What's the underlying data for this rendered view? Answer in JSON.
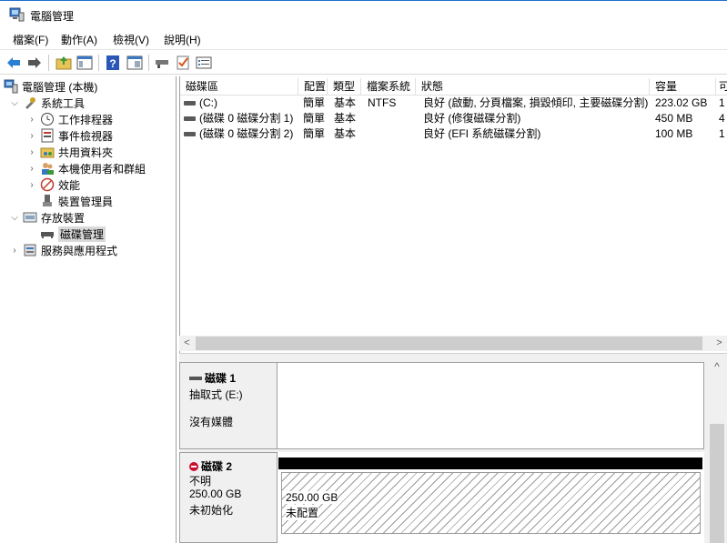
{
  "window": {
    "title": "電腦管理"
  },
  "menu": [
    "檔案(F)",
    "動作(A)",
    "檢視(V)",
    "說明(H)"
  ],
  "toolbar": [
    "back-icon",
    "forward-icon",
    "up-folder-icon",
    "console-tree-icon",
    "help-icon",
    "properties-icon",
    "connect-icon",
    "check-icon",
    "list-icon"
  ],
  "tree": [
    {
      "label": "電腦管理 (本機)",
      "icon": "computer-management-icon"
    },
    {
      "label": "系統工具",
      "icon": "system-tools-icon"
    },
    {
      "label": "工作排程器",
      "icon": "task-scheduler-icon"
    },
    {
      "label": "事件檢視器",
      "icon": "event-viewer-icon"
    },
    {
      "label": "共用資料夾",
      "icon": "shared-folders-icon"
    },
    {
      "label": "本機使用者和群組",
      "icon": "users-groups-icon"
    },
    {
      "label": "效能",
      "icon": "performance-icon"
    },
    {
      "label": "裝置管理員",
      "icon": "device-manager-icon"
    },
    {
      "label": "存放裝置",
      "icon": "storage-icon"
    },
    {
      "label": "磁碟管理",
      "icon": "disk-management-icon"
    },
    {
      "label": "服務與應用程式",
      "icon": "services-apps-icon"
    }
  ],
  "volumes": {
    "columns": [
      "磁碟區",
      "配置",
      "類型",
      "檔案系統",
      "狀態",
      "容量",
      "可"
    ],
    "rows": [
      {
        "name": "(C:)",
        "layout": "簡單",
        "type": "基本",
        "fs": "NTFS",
        "status": "良好 (啟動, 分頁檔案, 損毀傾印, 主要磁碟分割)",
        "capacity": "223.02 GB",
        "free": "1"
      },
      {
        "name": "(磁碟 0 磁碟分割 1)",
        "layout": "簡單",
        "type": "基本",
        "fs": "",
        "status": "良好 (修復磁碟分割)",
        "capacity": "450 MB",
        "free": "4"
      },
      {
        "name": "(磁碟 0 磁碟分割 2)",
        "layout": "簡單",
        "type": "基本",
        "fs": "",
        "status": "良好 (EFI 系統磁碟分割)",
        "capacity": "100 MB",
        "free": "1"
      }
    ]
  },
  "disks": [
    {
      "name": "磁碟 1",
      "line2": "抽取式 (E:)",
      "line3": "沒有媒體"
    },
    {
      "name": "磁碟 2",
      "line2": "不明",
      "line3": "250.00 GB",
      "line4": "未初始化",
      "partition_size": "250.00 GB",
      "partition_label": "未配置"
    }
  ],
  "colors": {
    "accent": "#1f6fd1",
    "unallocated_bar": "#000000",
    "error": "#c8102e"
  }
}
